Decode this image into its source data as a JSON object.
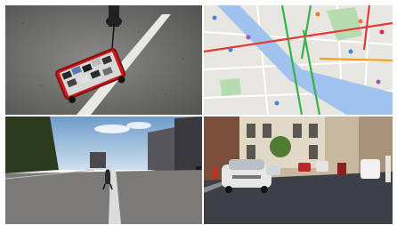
{
  "collage": {
    "panels": [
      {
        "subject": "red-wagon-with-phones"
      },
      {
        "subject": "map-traffic-view"
      },
      {
        "subject": "empty-street-view"
      },
      {
        "subject": "street-with-cars"
      }
    ]
  }
}
